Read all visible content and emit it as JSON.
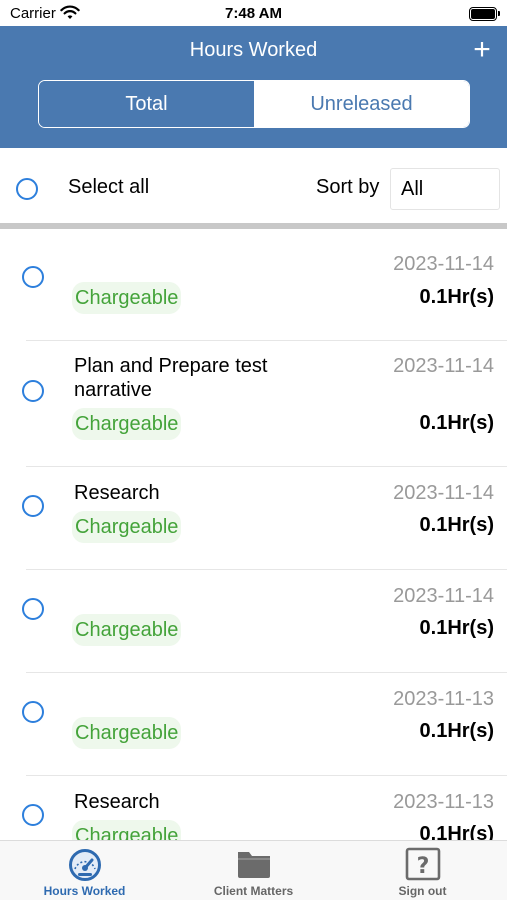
{
  "status_bar": {
    "carrier": "Carrier",
    "time": "7:48 AM"
  },
  "header": {
    "title": "Hours Worked",
    "add_label": "+",
    "tabs": [
      {
        "label": "Total",
        "selected": true
      },
      {
        "label": "Unreleased",
        "selected": false
      }
    ]
  },
  "toolbar": {
    "select_all_label": "Select all",
    "sort_label": "Sort by",
    "sort_value": "All"
  },
  "entries": [
    {
      "title": "",
      "badge": "Chargeable",
      "date": "2023-11-14",
      "hours": "0.1Hr(s)"
    },
    {
      "title": "Plan and Prepare test narrative",
      "badge": "Chargeable",
      "date": "2023-11-14",
      "hours": "0.1Hr(s)"
    },
    {
      "title": "Research",
      "badge": "Chargeable",
      "date": "2023-11-14",
      "hours": "0.1Hr(s)"
    },
    {
      "title": "",
      "badge": "Chargeable",
      "date": "2023-11-14",
      "hours": "0.1Hr(s)"
    },
    {
      "title": "",
      "badge": "Chargeable",
      "date": "2023-11-13",
      "hours": "0.1Hr(s)"
    },
    {
      "title": "Research",
      "badge": "Chargeable",
      "date": "2023-11-13",
      "hours": "0.1Hr(s)"
    }
  ],
  "tab_bar": [
    {
      "label": "Hours Worked",
      "icon": "speedometer-icon",
      "active": true
    },
    {
      "label": "Client Matters",
      "icon": "folder-icon",
      "active": false
    },
    {
      "label": "Sign out",
      "icon": "question-mark-icon",
      "active": false
    }
  ],
  "colors": {
    "header_blue": "#4a79b0",
    "radio_blue": "#2d7fdc",
    "badge_green": "#44a33a",
    "badge_bg": "#eef8ec",
    "tab_active": "#2e6ab0",
    "tab_inactive": "#666666"
  }
}
